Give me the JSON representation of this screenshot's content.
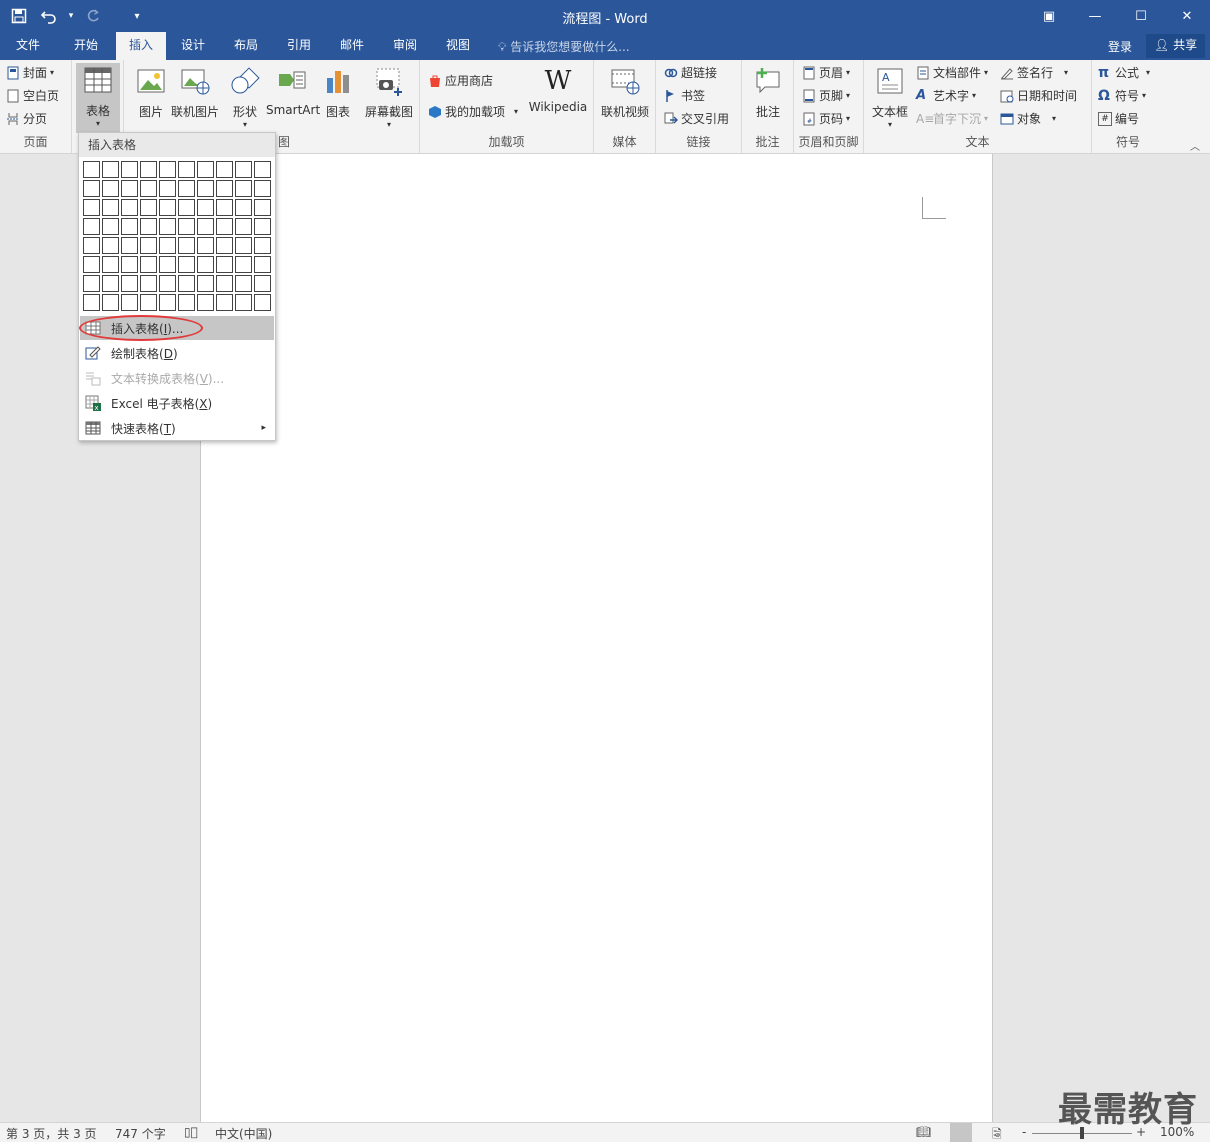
{
  "window": {
    "title": "流程图 - Word",
    "controls": {
      "ribbon_display": "▣",
      "minimize": "—",
      "maximize": "☐",
      "close": "✕"
    }
  },
  "tabs": [
    "文件",
    "开始",
    "插入",
    "设计",
    "布局",
    "引用",
    "邮件",
    "审阅",
    "视图"
  ],
  "active_tab": "插入",
  "tell_me": "告诉我您想要做什么...",
  "account": {
    "signin": "登录",
    "share": "共享"
  },
  "ribbon": {
    "pages": {
      "label": "页面",
      "items": [
        "封面",
        "空白页",
        "分页"
      ]
    },
    "tables": {
      "label": "表格"
    },
    "illustrations": {
      "label": "图",
      "items": [
        "图片",
        "联机图片",
        "形状",
        "SmartArt",
        "图表",
        "屏幕截图"
      ]
    },
    "addins": {
      "label": "加载项",
      "store": "应用商店",
      "myaddins": "我的加载项",
      "wikipedia": "Wikipedia"
    },
    "media": {
      "label": "媒体",
      "online_video": "联机视频"
    },
    "links": {
      "label": "链接",
      "items": [
        "超链接",
        "书签",
        "交叉引用"
      ]
    },
    "comments": {
      "label": "批注",
      "comment": "批注"
    },
    "header_footer": {
      "label": "页眉和页脚",
      "items": [
        "页眉",
        "页脚",
        "页码"
      ]
    },
    "text": {
      "label": "文本",
      "textbox": "文本框",
      "items": [
        "文档部件",
        "艺术字",
        "首字下沉",
        "签名行",
        "日期和时间",
        "对象"
      ]
    },
    "symbols": {
      "label": "符号",
      "items": [
        "公式",
        "符号",
        "编号"
      ]
    }
  },
  "dropdown": {
    "header": "插入表格",
    "grid_cols": 10,
    "grid_rows": 8,
    "items": [
      {
        "label": "插入表格(",
        "key": "I",
        "suffix": ")...",
        "state": "highlighted"
      },
      {
        "label": "绘制表格(",
        "key": "D",
        "suffix": ")",
        "state": "normal"
      },
      {
        "label": "文本转换成表格(",
        "key": "V",
        "suffix": ")...",
        "state": "disabled"
      },
      {
        "label": "Excel 电子表格(",
        "key": "X",
        "suffix": ")",
        "state": "normal"
      },
      {
        "label": "快速表格(",
        "key": "T",
        "suffix": ")",
        "state": "normal",
        "submenu": "▸"
      }
    ]
  },
  "status": {
    "page": "第 3 页，共 3 页",
    "words": "747 个字",
    "language": "中文(中国)",
    "zoom": "100%",
    "zoom_minus": "-",
    "zoom_plus": "+"
  },
  "watermark": "最需教育",
  "colors": {
    "accent": "#2b579a",
    "annotation": "#e23a3a"
  }
}
